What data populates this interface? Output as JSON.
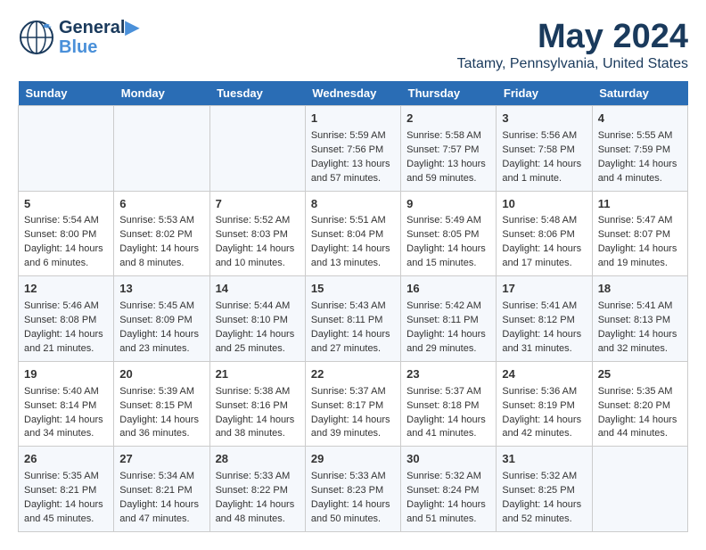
{
  "header": {
    "logo_general": "General",
    "logo_blue": "Blue",
    "month": "May 2024",
    "location": "Tatamy, Pennsylvania, United States"
  },
  "days_of_week": [
    "Sunday",
    "Monday",
    "Tuesday",
    "Wednesday",
    "Thursday",
    "Friday",
    "Saturday"
  ],
  "weeks": [
    {
      "cells": [
        {
          "day": "",
          "content": ""
        },
        {
          "day": "",
          "content": ""
        },
        {
          "day": "",
          "content": ""
        },
        {
          "day": "1",
          "content": "Sunrise: 5:59 AM\nSunset: 7:56 PM\nDaylight: 13 hours and 57 minutes."
        },
        {
          "day": "2",
          "content": "Sunrise: 5:58 AM\nSunset: 7:57 PM\nDaylight: 13 hours and 59 minutes."
        },
        {
          "day": "3",
          "content": "Sunrise: 5:56 AM\nSunset: 7:58 PM\nDaylight: 14 hours and 1 minute."
        },
        {
          "day": "4",
          "content": "Sunrise: 5:55 AM\nSunset: 7:59 PM\nDaylight: 14 hours and 4 minutes."
        }
      ]
    },
    {
      "cells": [
        {
          "day": "5",
          "content": "Sunrise: 5:54 AM\nSunset: 8:00 PM\nDaylight: 14 hours and 6 minutes."
        },
        {
          "day": "6",
          "content": "Sunrise: 5:53 AM\nSunset: 8:02 PM\nDaylight: 14 hours and 8 minutes."
        },
        {
          "day": "7",
          "content": "Sunrise: 5:52 AM\nSunset: 8:03 PM\nDaylight: 14 hours and 10 minutes."
        },
        {
          "day": "8",
          "content": "Sunrise: 5:51 AM\nSunset: 8:04 PM\nDaylight: 14 hours and 13 minutes."
        },
        {
          "day": "9",
          "content": "Sunrise: 5:49 AM\nSunset: 8:05 PM\nDaylight: 14 hours and 15 minutes."
        },
        {
          "day": "10",
          "content": "Sunrise: 5:48 AM\nSunset: 8:06 PM\nDaylight: 14 hours and 17 minutes."
        },
        {
          "day": "11",
          "content": "Sunrise: 5:47 AM\nSunset: 8:07 PM\nDaylight: 14 hours and 19 minutes."
        }
      ]
    },
    {
      "cells": [
        {
          "day": "12",
          "content": "Sunrise: 5:46 AM\nSunset: 8:08 PM\nDaylight: 14 hours and 21 minutes."
        },
        {
          "day": "13",
          "content": "Sunrise: 5:45 AM\nSunset: 8:09 PM\nDaylight: 14 hours and 23 minutes."
        },
        {
          "day": "14",
          "content": "Sunrise: 5:44 AM\nSunset: 8:10 PM\nDaylight: 14 hours and 25 minutes."
        },
        {
          "day": "15",
          "content": "Sunrise: 5:43 AM\nSunset: 8:11 PM\nDaylight: 14 hours and 27 minutes."
        },
        {
          "day": "16",
          "content": "Sunrise: 5:42 AM\nSunset: 8:11 PM\nDaylight: 14 hours and 29 minutes."
        },
        {
          "day": "17",
          "content": "Sunrise: 5:41 AM\nSunset: 8:12 PM\nDaylight: 14 hours and 31 minutes."
        },
        {
          "day": "18",
          "content": "Sunrise: 5:41 AM\nSunset: 8:13 PM\nDaylight: 14 hours and 32 minutes."
        }
      ]
    },
    {
      "cells": [
        {
          "day": "19",
          "content": "Sunrise: 5:40 AM\nSunset: 8:14 PM\nDaylight: 14 hours and 34 minutes."
        },
        {
          "day": "20",
          "content": "Sunrise: 5:39 AM\nSunset: 8:15 PM\nDaylight: 14 hours and 36 minutes."
        },
        {
          "day": "21",
          "content": "Sunrise: 5:38 AM\nSunset: 8:16 PM\nDaylight: 14 hours and 38 minutes."
        },
        {
          "day": "22",
          "content": "Sunrise: 5:37 AM\nSunset: 8:17 PM\nDaylight: 14 hours and 39 minutes."
        },
        {
          "day": "23",
          "content": "Sunrise: 5:37 AM\nSunset: 8:18 PM\nDaylight: 14 hours and 41 minutes."
        },
        {
          "day": "24",
          "content": "Sunrise: 5:36 AM\nSunset: 8:19 PM\nDaylight: 14 hours and 42 minutes."
        },
        {
          "day": "25",
          "content": "Sunrise: 5:35 AM\nSunset: 8:20 PM\nDaylight: 14 hours and 44 minutes."
        }
      ]
    },
    {
      "cells": [
        {
          "day": "26",
          "content": "Sunrise: 5:35 AM\nSunset: 8:21 PM\nDaylight: 14 hours and 45 minutes."
        },
        {
          "day": "27",
          "content": "Sunrise: 5:34 AM\nSunset: 8:21 PM\nDaylight: 14 hours and 47 minutes."
        },
        {
          "day": "28",
          "content": "Sunrise: 5:33 AM\nSunset: 8:22 PM\nDaylight: 14 hours and 48 minutes."
        },
        {
          "day": "29",
          "content": "Sunrise: 5:33 AM\nSunset: 8:23 PM\nDaylight: 14 hours and 50 minutes."
        },
        {
          "day": "30",
          "content": "Sunrise: 5:32 AM\nSunset: 8:24 PM\nDaylight: 14 hours and 51 minutes."
        },
        {
          "day": "31",
          "content": "Sunrise: 5:32 AM\nSunset: 8:25 PM\nDaylight: 14 hours and 52 minutes."
        },
        {
          "day": "",
          "content": ""
        }
      ]
    }
  ]
}
